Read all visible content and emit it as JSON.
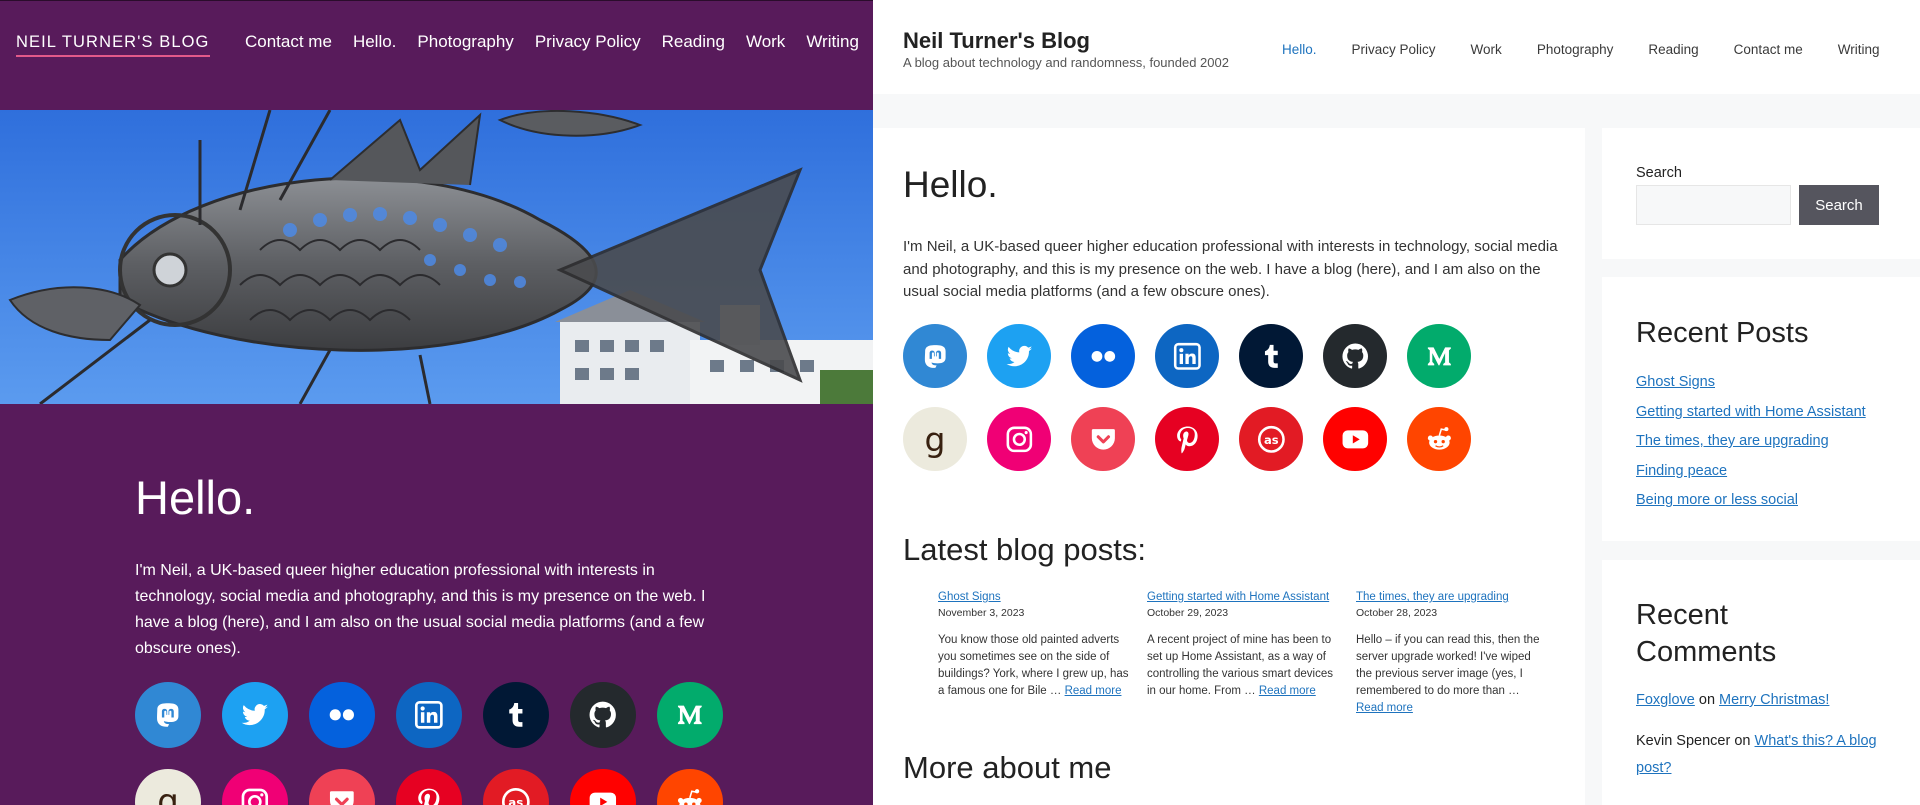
{
  "left": {
    "brand": "NEIL TURNER'S BLOG",
    "nav": [
      "Contact me",
      "Hello.",
      "Photography",
      "Privacy Policy",
      "Reading",
      "Work",
      "Writing"
    ],
    "hero_image": "fish-sculpture",
    "title": "Hello.",
    "intro": "I'm Neil, a UK-based queer higher education professional with interests in technology, social media and photography, and this is my presence on the web. I have a blog (here), and I am also on the usual social media platforms (and a few obscure ones).",
    "social_icons": [
      "mastodon-icon",
      "twitter-icon",
      "flickr-icon",
      "linkedin-icon",
      "tumblr-icon",
      "github-icon",
      "medium-icon",
      "goodreads-icon",
      "instagram-icon",
      "pocket-icon",
      "pinterest-icon",
      "lastfm-icon",
      "youtube-icon",
      "reddit-icon"
    ]
  },
  "right": {
    "site_title": "Neil Turner's Blog",
    "tagline": "A blog about technology and randomness, founded 2002",
    "nav": [
      "Hello.",
      "Privacy Policy",
      "Work",
      "Photography",
      "Reading",
      "Contact me",
      "Writing"
    ],
    "nav_active": "Hello.",
    "title": "Hello.",
    "intro": "I'm Neil, a UK-based queer higher education professional with interests in technology, social media and photography, and this is my presence on the web. I have a blog (here), and I am also on the usual social media platforms (and a few obscure ones).",
    "latest_title": "Latest blog posts:",
    "posts": [
      {
        "title": "Ghost Signs",
        "date": "November 3, 2023",
        "excerpt": "You know those old painted adverts you sometimes see on the side of buildings? York, where I grew up, has a famous one for Bile …",
        "more": "Read more"
      },
      {
        "title": "Getting started with Home Assistant",
        "date": "October 29, 2023",
        "excerpt": "A recent project of mine has been to set up Home Assistant, as a way of controlling the various smart devices in our home. From …",
        "more": "Read more"
      },
      {
        "title": "The times, they are upgrading",
        "date": "October 28, 2023",
        "excerpt": "Hello – if you can read this, then the server upgrade worked! I've wiped the previous server image (yes, I remembered to do more than …",
        "more": "Read more"
      }
    ],
    "more_title": "More about me",
    "search": {
      "label": "Search",
      "value": "",
      "placeholder": "",
      "button": "Search"
    },
    "recent_posts": {
      "title": "Recent Posts",
      "items": [
        "Ghost Signs",
        "Getting started with Home Assistant",
        "The times, they are upgrading",
        "Finding peace",
        "Being more or less social"
      ]
    },
    "recent_comments": {
      "title": "Recent Comments",
      "items": [
        {
          "author": "Foxglove",
          "on": "on",
          "post": "Merry Christmas!"
        },
        {
          "author": "Kevin Spencer",
          "on": "on",
          "post": "What's this? A blog post?"
        }
      ]
    }
  },
  "colors": {
    "left_bg": "#581b5b",
    "accent_underline": "#e25a8a",
    "link": "#1e73be",
    "search_button": "#55555e"
  }
}
